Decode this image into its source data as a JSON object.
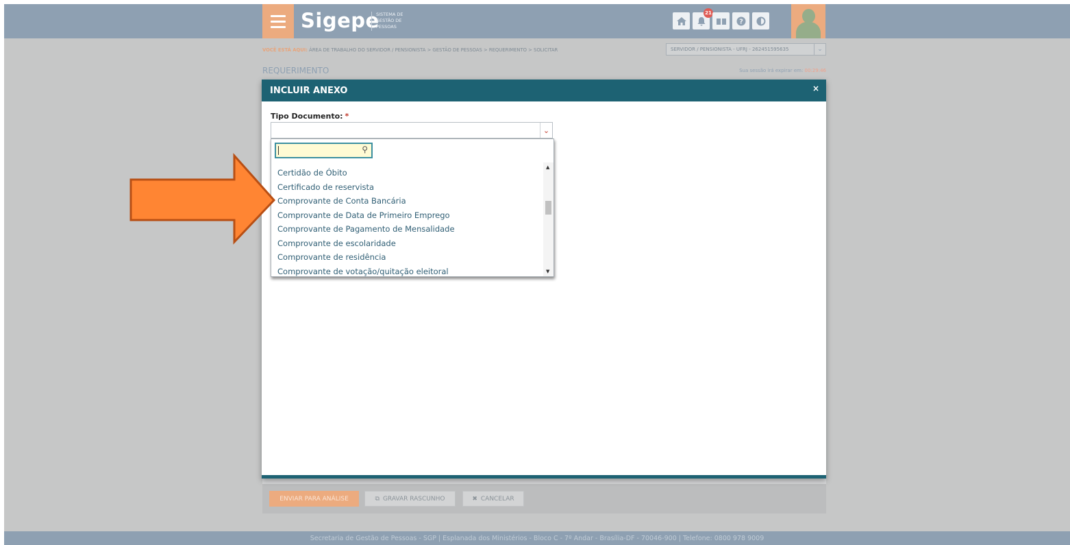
{
  "header": {
    "logo": "Sigepe",
    "logo_subtitle": "SISTEMA DE GESTÃO DE PESSOAS",
    "notification_count": "21"
  },
  "breadcrumb": {
    "prefix": "VOCÊ ESTÁ AQUI:",
    "path": "ÁREA DE TRABALHO DO SERVIDOR / PENSIONISTA  >  GESTÃO DE PESSOAS  >  REQUERIMENTO  >  SOLICITAR"
  },
  "profile_select": {
    "value": "SERVIDOR / PENSIONISTA - UFRJ - 262451595635"
  },
  "page": {
    "title": "REQUERIMENTO",
    "session_label": "Sua sessão irá expirar em:",
    "session_time": "00:29:46"
  },
  "modal": {
    "title": "INCLUIR ANEXO",
    "close": "×",
    "field_label": "Tipo Documento:",
    "required_mark": "*",
    "select_value": "",
    "search_value": "",
    "options": [
      "Certidão de Óbito",
      "Certificado de reservista",
      "Comprovante de Conta Bancária",
      "Comprovante de Data de Primeiro Emprego",
      "Comprovante de Pagamento de Mensalidade",
      "Comprovante de escolaridade",
      "Comprovante de residência",
      "Comprovante de votação/quitação eleitoral"
    ]
  },
  "actions": {
    "submit": "ENVIAR PARA ANÁLISE",
    "save_draft": "GRAVAR RASCUNHO",
    "cancel": "CANCELAR"
  },
  "footer": {
    "text": "Secretaria de Gestão de Pessoas - SGP | Esplanada dos Ministérios - Bloco C - 7º Andar - Brasília-DF - 70046-900 | Telefone: 0800 978 9009"
  },
  "colors": {
    "header_bg": "#8ea0b2",
    "accent_orange": "#ecab7f",
    "modal_header": "#1d6273",
    "arrow": "#ff8533"
  },
  "icons": [
    "menu-icon",
    "home-icon",
    "bell-icon",
    "book-icon",
    "help-icon",
    "contrast-icon",
    "user-avatar",
    "search-icon",
    "chevron-down-icon",
    "close-icon"
  ]
}
